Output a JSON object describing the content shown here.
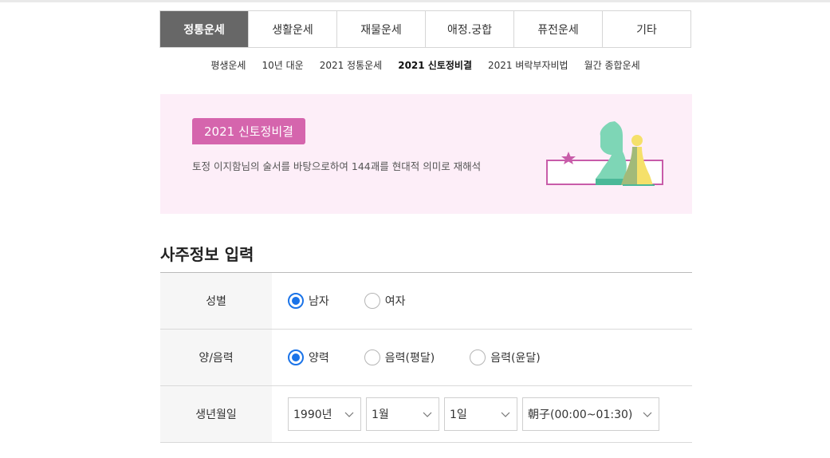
{
  "tabs": [
    "정통운세",
    "생활운세",
    "재물운세",
    "애정.궁합",
    "퓨전운세",
    "기타"
  ],
  "subnav": [
    "평생운세",
    "10년 대운",
    "2021 정통운세",
    "2021 신토정비결",
    "2021 벼락부자비법",
    "월간 종합운세"
  ],
  "banner": {
    "badge": "2021 신토정비결",
    "description": "토정 이지함님의 술서를 바탕으로하여 144괘를 현대적 의미로 재해석",
    "colors": {
      "background": "#fdeef8",
      "badge": "#d565ad"
    }
  },
  "form": {
    "title": "사주정보 입력",
    "gender": {
      "label": "성별",
      "options": [
        "남자",
        "여자"
      ],
      "selected": "남자"
    },
    "calendar": {
      "label": "양/음력",
      "options": [
        "양력",
        "음력(평달)",
        "음력(윤달)"
      ],
      "selected": "양력"
    },
    "birth": {
      "label": "생년월일",
      "year": "1990년",
      "month": "1월",
      "day": "1일",
      "time": "朝子(00:00~01:30)"
    }
  },
  "accent_color": "#1a73e8"
}
